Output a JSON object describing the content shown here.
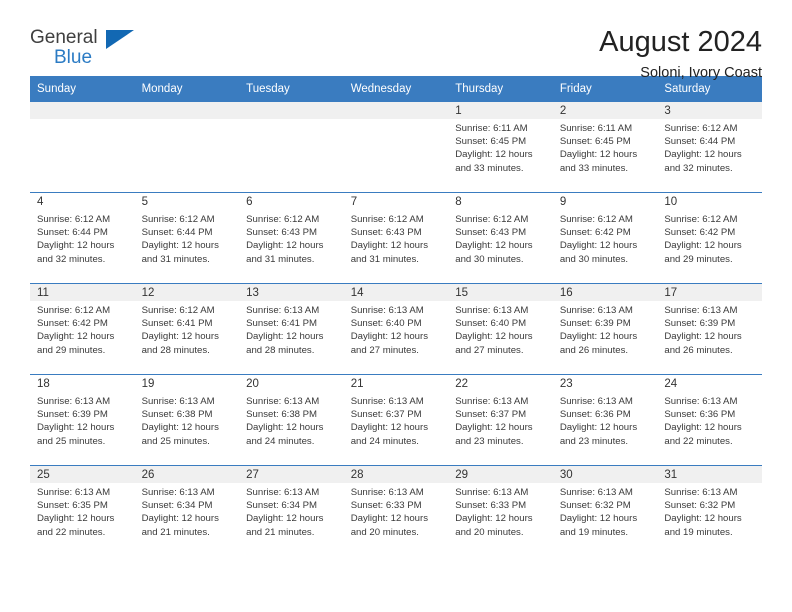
{
  "brand": {
    "name_part1": "General",
    "name_part2": "Blue",
    "triangle_color": "#1268b3",
    "blue_text_color": "#2b7bc4"
  },
  "header": {
    "title": "August 2024",
    "subtitle": "Soloni, Ivory Coast",
    "header_bg_color": "#3a7cc0",
    "band_color": "#f0f0f0"
  },
  "weekday_headers": [
    "Sunday",
    "Monday",
    "Tuesday",
    "Wednesday",
    "Thursday",
    "Friday",
    "Saturday"
  ],
  "weeks": [
    [
      {
        "day": "",
        "sunrise": "",
        "sunset": "",
        "daylight1": "",
        "daylight2": ""
      },
      {
        "day": "",
        "sunrise": "",
        "sunset": "",
        "daylight1": "",
        "daylight2": ""
      },
      {
        "day": "",
        "sunrise": "",
        "sunset": "",
        "daylight1": "",
        "daylight2": ""
      },
      {
        "day": "",
        "sunrise": "",
        "sunset": "",
        "daylight1": "",
        "daylight2": ""
      },
      {
        "day": "1",
        "sunrise": "Sunrise: 6:11 AM",
        "sunset": "Sunset: 6:45 PM",
        "daylight1": "Daylight: 12 hours",
        "daylight2": "and 33 minutes."
      },
      {
        "day": "2",
        "sunrise": "Sunrise: 6:11 AM",
        "sunset": "Sunset: 6:45 PM",
        "daylight1": "Daylight: 12 hours",
        "daylight2": "and 33 minutes."
      },
      {
        "day": "3",
        "sunrise": "Sunrise: 6:12 AM",
        "sunset": "Sunset: 6:44 PM",
        "daylight1": "Daylight: 12 hours",
        "daylight2": "and 32 minutes."
      }
    ],
    [
      {
        "day": "4",
        "sunrise": "Sunrise: 6:12 AM",
        "sunset": "Sunset: 6:44 PM",
        "daylight1": "Daylight: 12 hours",
        "daylight2": "and 32 minutes."
      },
      {
        "day": "5",
        "sunrise": "Sunrise: 6:12 AM",
        "sunset": "Sunset: 6:44 PM",
        "daylight1": "Daylight: 12 hours",
        "daylight2": "and 31 minutes."
      },
      {
        "day": "6",
        "sunrise": "Sunrise: 6:12 AM",
        "sunset": "Sunset: 6:43 PM",
        "daylight1": "Daylight: 12 hours",
        "daylight2": "and 31 minutes."
      },
      {
        "day": "7",
        "sunrise": "Sunrise: 6:12 AM",
        "sunset": "Sunset: 6:43 PM",
        "daylight1": "Daylight: 12 hours",
        "daylight2": "and 31 minutes."
      },
      {
        "day": "8",
        "sunrise": "Sunrise: 6:12 AM",
        "sunset": "Sunset: 6:43 PM",
        "daylight1": "Daylight: 12 hours",
        "daylight2": "and 30 minutes."
      },
      {
        "day": "9",
        "sunrise": "Sunrise: 6:12 AM",
        "sunset": "Sunset: 6:42 PM",
        "daylight1": "Daylight: 12 hours",
        "daylight2": "and 30 minutes."
      },
      {
        "day": "10",
        "sunrise": "Sunrise: 6:12 AM",
        "sunset": "Sunset: 6:42 PM",
        "daylight1": "Daylight: 12 hours",
        "daylight2": "and 29 minutes."
      }
    ],
    [
      {
        "day": "11",
        "sunrise": "Sunrise: 6:12 AM",
        "sunset": "Sunset: 6:42 PM",
        "daylight1": "Daylight: 12 hours",
        "daylight2": "and 29 minutes."
      },
      {
        "day": "12",
        "sunrise": "Sunrise: 6:12 AM",
        "sunset": "Sunset: 6:41 PM",
        "daylight1": "Daylight: 12 hours",
        "daylight2": "and 28 minutes."
      },
      {
        "day": "13",
        "sunrise": "Sunrise: 6:13 AM",
        "sunset": "Sunset: 6:41 PM",
        "daylight1": "Daylight: 12 hours",
        "daylight2": "and 28 minutes."
      },
      {
        "day": "14",
        "sunrise": "Sunrise: 6:13 AM",
        "sunset": "Sunset: 6:40 PM",
        "daylight1": "Daylight: 12 hours",
        "daylight2": "and 27 minutes."
      },
      {
        "day": "15",
        "sunrise": "Sunrise: 6:13 AM",
        "sunset": "Sunset: 6:40 PM",
        "daylight1": "Daylight: 12 hours",
        "daylight2": "and 27 minutes."
      },
      {
        "day": "16",
        "sunrise": "Sunrise: 6:13 AM",
        "sunset": "Sunset: 6:39 PM",
        "daylight1": "Daylight: 12 hours",
        "daylight2": "and 26 minutes."
      },
      {
        "day": "17",
        "sunrise": "Sunrise: 6:13 AM",
        "sunset": "Sunset: 6:39 PM",
        "daylight1": "Daylight: 12 hours",
        "daylight2": "and 26 minutes."
      }
    ],
    [
      {
        "day": "18",
        "sunrise": "Sunrise: 6:13 AM",
        "sunset": "Sunset: 6:39 PM",
        "daylight1": "Daylight: 12 hours",
        "daylight2": "and 25 minutes."
      },
      {
        "day": "19",
        "sunrise": "Sunrise: 6:13 AM",
        "sunset": "Sunset: 6:38 PM",
        "daylight1": "Daylight: 12 hours",
        "daylight2": "and 25 minutes."
      },
      {
        "day": "20",
        "sunrise": "Sunrise: 6:13 AM",
        "sunset": "Sunset: 6:38 PM",
        "daylight1": "Daylight: 12 hours",
        "daylight2": "and 24 minutes."
      },
      {
        "day": "21",
        "sunrise": "Sunrise: 6:13 AM",
        "sunset": "Sunset: 6:37 PM",
        "daylight1": "Daylight: 12 hours",
        "daylight2": "and 24 minutes."
      },
      {
        "day": "22",
        "sunrise": "Sunrise: 6:13 AM",
        "sunset": "Sunset: 6:37 PM",
        "daylight1": "Daylight: 12 hours",
        "daylight2": "and 23 minutes."
      },
      {
        "day": "23",
        "sunrise": "Sunrise: 6:13 AM",
        "sunset": "Sunset: 6:36 PM",
        "daylight1": "Daylight: 12 hours",
        "daylight2": "and 23 minutes."
      },
      {
        "day": "24",
        "sunrise": "Sunrise: 6:13 AM",
        "sunset": "Sunset: 6:36 PM",
        "daylight1": "Daylight: 12 hours",
        "daylight2": "and 22 minutes."
      }
    ],
    [
      {
        "day": "25",
        "sunrise": "Sunrise: 6:13 AM",
        "sunset": "Sunset: 6:35 PM",
        "daylight1": "Daylight: 12 hours",
        "daylight2": "and 22 minutes."
      },
      {
        "day": "26",
        "sunrise": "Sunrise: 6:13 AM",
        "sunset": "Sunset: 6:34 PM",
        "daylight1": "Daylight: 12 hours",
        "daylight2": "and 21 minutes."
      },
      {
        "day": "27",
        "sunrise": "Sunrise: 6:13 AM",
        "sunset": "Sunset: 6:34 PM",
        "daylight1": "Daylight: 12 hours",
        "daylight2": "and 21 minutes."
      },
      {
        "day": "28",
        "sunrise": "Sunrise: 6:13 AM",
        "sunset": "Sunset: 6:33 PM",
        "daylight1": "Daylight: 12 hours",
        "daylight2": "and 20 minutes."
      },
      {
        "day": "29",
        "sunrise": "Sunrise: 6:13 AM",
        "sunset": "Sunset: 6:33 PM",
        "daylight1": "Daylight: 12 hours",
        "daylight2": "and 20 minutes."
      },
      {
        "day": "30",
        "sunrise": "Sunrise: 6:13 AM",
        "sunset": "Sunset: 6:32 PM",
        "daylight1": "Daylight: 12 hours",
        "daylight2": "and 19 minutes."
      },
      {
        "day": "31",
        "sunrise": "Sunrise: 6:13 AM",
        "sunset": "Sunset: 6:32 PM",
        "daylight1": "Daylight: 12 hours",
        "daylight2": "and 19 minutes."
      }
    ]
  ]
}
